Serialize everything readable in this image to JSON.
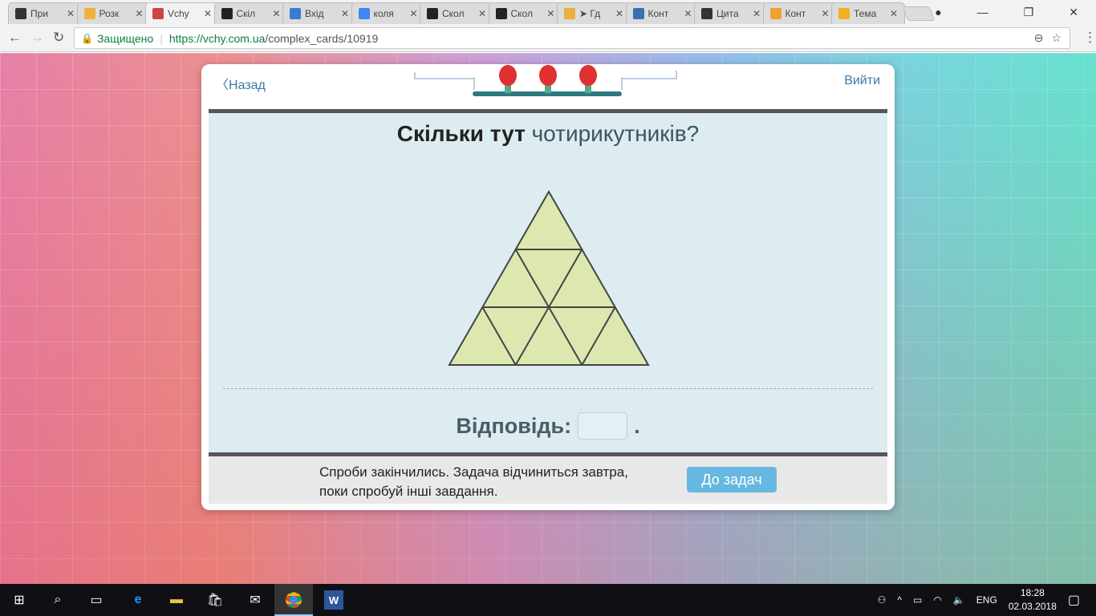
{
  "browser": {
    "tabs": [
      {
        "title": "При",
        "icon": "N7",
        "color": "#333"
      },
      {
        "title": "Розк",
        "icon": "hand",
        "color": "#f0b040"
      },
      {
        "title": "Vchy",
        "icon": "vchy",
        "color": "#c44",
        "active": true
      },
      {
        "title": "Скіл",
        "icon": "3",
        "color": "#222"
      },
      {
        "title": "Вхід",
        "icon": "i",
        "color": "#3a7ad0"
      },
      {
        "title": "коля",
        "icon": "G",
        "color": "#4285f4"
      },
      {
        "title": "Скол",
        "icon": "3",
        "color": "#222"
      },
      {
        "title": "Скол",
        "icon": "3",
        "color": "#222"
      },
      {
        "title": "➤ Гд",
        "icon": "pencil",
        "color": "#e8b040"
      },
      {
        "title": "Конт",
        "icon": "book",
        "color": "#3a70b0"
      },
      {
        "title": "Цита",
        "icon": "N7",
        "color": "#333"
      },
      {
        "title": "Конт",
        "icon": "S",
        "color": "#f0a030"
      },
      {
        "title": "Тема",
        "icon": "chart",
        "color": "#f0b020"
      }
    ],
    "secure_label": "Защищено",
    "url_host": "https://vchy.com.ua",
    "url_path": "/complex_cards/10919"
  },
  "card": {
    "back_label": "Назад",
    "exit_label": "Вийти",
    "attempts_bulbs": 3,
    "question_part1": "Скільки тут",
    "question_part2": "чотирикутників?",
    "answer_label": "Відповідь:",
    "answer_value": "",
    "answer_suffix": ".",
    "message": "Спроби закінчились. Задача відчиниться завтра, поки спробуй інші завдання.",
    "button_label": "До задач"
  },
  "taskbar": {
    "lang": "ENG",
    "time": "18:28",
    "date": "02.03.2018"
  },
  "colors": {
    "accent": "#66b8e0",
    "link": "#3a7aa8",
    "triangle_fill": "#dde8b0",
    "bulb": "#e03030"
  }
}
